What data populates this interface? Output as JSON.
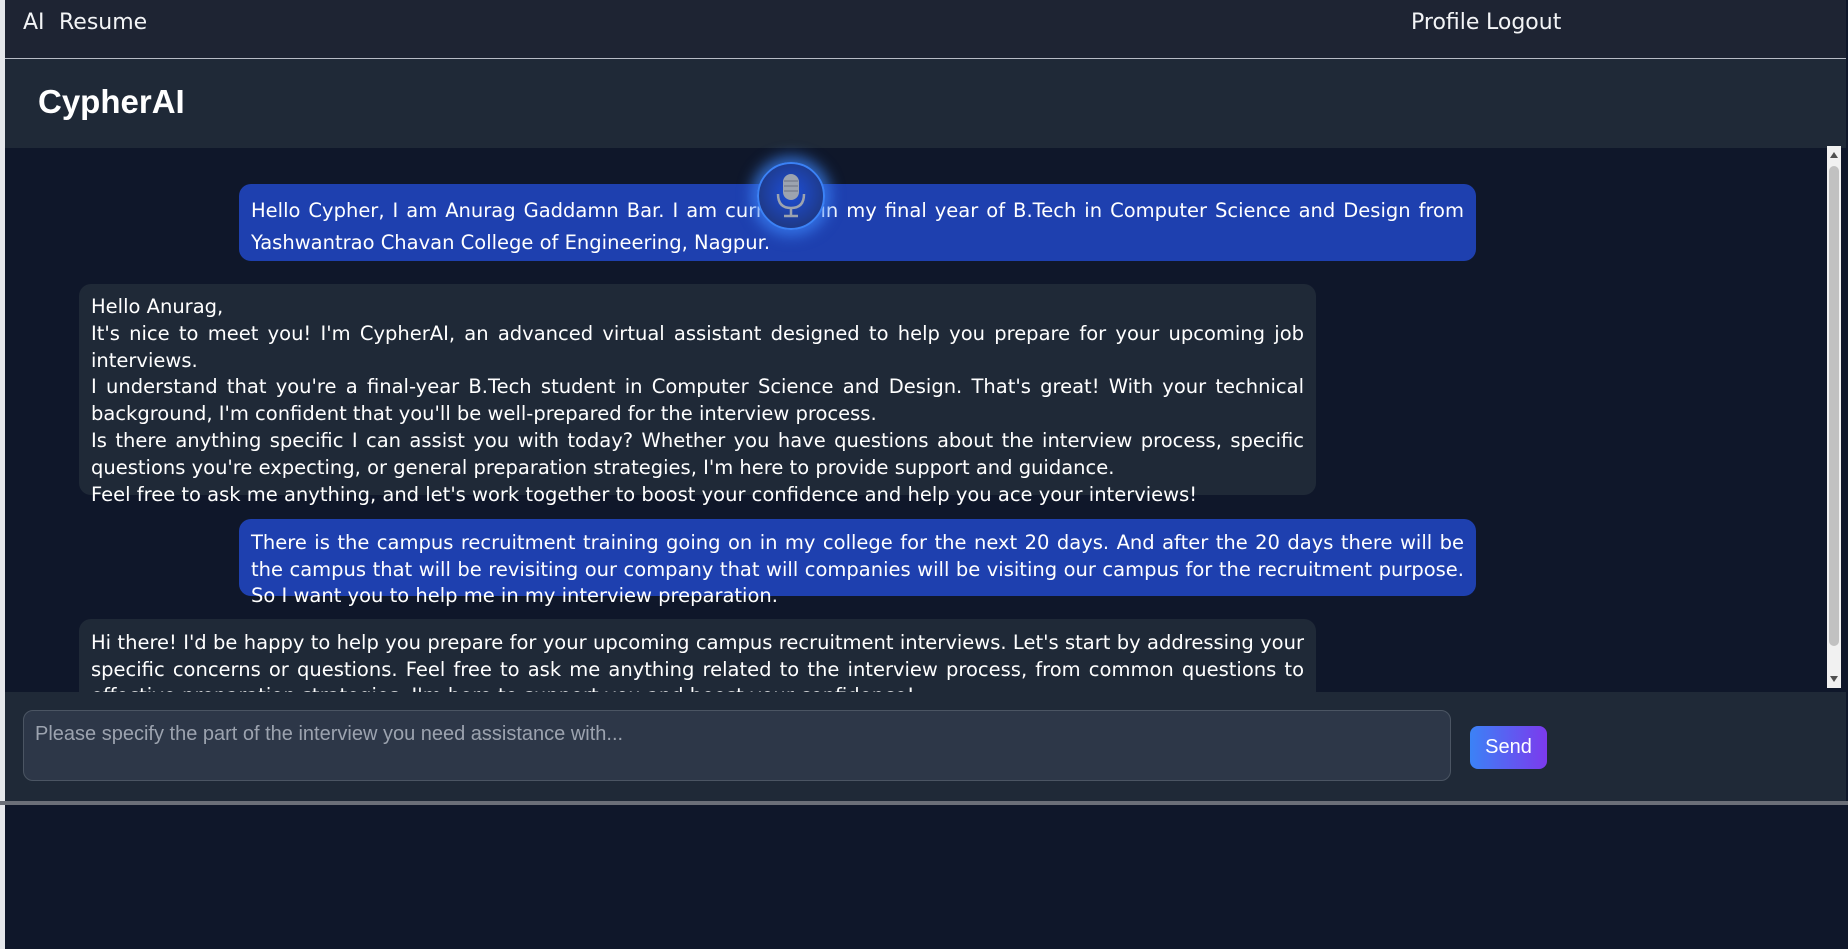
{
  "nav": {
    "left": [
      "AI",
      "Resume"
    ],
    "right": [
      "Profile",
      "Logout"
    ]
  },
  "header": {
    "title": "CypherAI"
  },
  "messages": [
    {
      "role": "user",
      "paragraphs": [
        "Hello Cypher, I am Anurag Gaddamn Bar. I am currently in my final year of B.Tech in Computer Science and Design from Yashwantrao Chavan College of Engineering, Nagpur."
      ]
    },
    {
      "role": "bot",
      "paragraphs": [
        "Hello Anurag,",
        "It's nice to meet you! I'm CypherAI, an advanced virtual assistant designed to help you prepare for your upcoming job interviews.",
        "I understand that you're a final-year B.Tech student in Computer Science and Design. That's great! With your technical background, I'm confident that you'll be well-prepared for the interview process.",
        "Is there anything specific I can assist you with today? Whether you have questions about the interview process, specific questions you're expecting, or general preparation strategies, I'm here to provide support and guidance.",
        "Feel free to ask me anything, and let's work together to boost your confidence and help you ace your interviews!"
      ]
    },
    {
      "role": "user",
      "paragraphs": [
        "There is the campus recruitment training going on in my college for the next 20 days. And after the 20 days there will be the campus that will be revisiting our company that will companies will be visiting our campus for the recruitment purpose. So I want you to help me in my interview preparation."
      ]
    },
    {
      "role": "bot",
      "paragraphs": [
        "Hi there! I'd be happy to help you prepare for your upcoming campus recruitment interviews. Let's start by addressing your specific concerns or questions. Feel free to ask me anything related to the interview process, from common questions to effective preparation strategies. I'm here to support you and boost your confidence!"
      ]
    }
  ],
  "composer": {
    "placeholder": "Please specify the part of the interview you need assistance with...",
    "value": "",
    "send_label": "Send"
  },
  "icons": {
    "mic": "microphone-icon"
  },
  "colors": {
    "user_bubble": "#1e40af",
    "bot_bubble": "#1f2937",
    "send_gradient_start": "#3b82f6",
    "send_gradient_end": "#7c3aed"
  }
}
